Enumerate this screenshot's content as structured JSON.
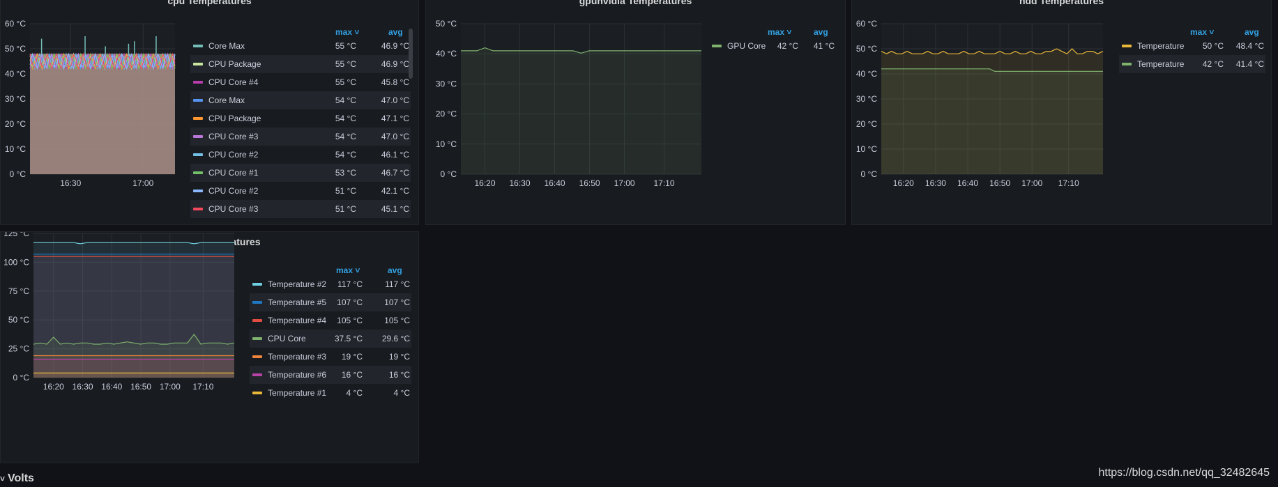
{
  "panels": {
    "cpu": {
      "title": "cpu Temperatures",
      "legend_headers": {
        "max": "max ˅",
        "avg": "avg"
      },
      "legend": [
        {
          "name": "Core Max",
          "max": "55 °C",
          "avg": "46.9 °C",
          "color": "#73bfb8"
        },
        {
          "name": "CPU Package",
          "max": "55 °C",
          "avg": "46.9 °C",
          "color": "#c8e6a0"
        },
        {
          "name": "CPU Core #4",
          "max": "55 °C",
          "avg": "45.8 °C",
          "color": "#b73dae"
        },
        {
          "name": "Core Max",
          "max": "54 °C",
          "avg": "47.0 °C",
          "color": "#5794f2"
        },
        {
          "name": "CPU Package",
          "max": "54 °C",
          "avg": "47.1 °C",
          "color": "#ff9830"
        },
        {
          "name": "CPU Core #3",
          "max": "54 °C",
          "avg": "47.0 °C",
          "color": "#b877d9"
        },
        {
          "name": "CPU Core #2",
          "max": "54 °C",
          "avg": "46.1 °C",
          "color": "#73bfe8"
        },
        {
          "name": "CPU Core #1",
          "max": "53 °C",
          "avg": "46.7 °C",
          "color": "#73bf69"
        },
        {
          "name": "CPU Core #2",
          "max": "51 °C",
          "avg": "42.1 °C",
          "color": "#8ab8ff"
        },
        {
          "name": "CPU Core #3",
          "max": "51 °C",
          "avg": "45.1 °C",
          "color": "#f2495c"
        }
      ]
    },
    "gpu": {
      "title": "gpunvidia Temperatures",
      "legend_headers": {
        "max": "max ˅",
        "avg": "avg"
      },
      "legend": [
        {
          "name": "GPU Core",
          "max": "42 °C",
          "avg": "41 °C",
          "color": "#7eb26d"
        }
      ]
    },
    "hdd": {
      "title": "hdd Temperatures",
      "legend_headers": {
        "max": "max ˅",
        "avg": "avg"
      },
      "legend": [
        {
          "name": "Temperature",
          "max": "50 °C",
          "avg": "48.4 °C",
          "color": "#eab839"
        },
        {
          "name": "Temperature",
          "max": "42 °C",
          "avg": "41.4 °C",
          "color": "#7eb26d"
        }
      ]
    },
    "superio": {
      "title": "superio Temperatures",
      "legend_headers": {
        "max": "max ˅",
        "avg": "avg"
      },
      "legend": [
        {
          "name": "Temperature #2",
          "max": "117 °C",
          "avg": "117 °C",
          "color": "#6ed0e0"
        },
        {
          "name": "Temperature #5",
          "max": "107 °C",
          "avg": "107 °C",
          "color": "#1f78c1"
        },
        {
          "name": "Temperature #4",
          "max": "105 °C",
          "avg": "105 °C",
          "color": "#e24d42"
        },
        {
          "name": "CPU Core",
          "max": "37.5 °C",
          "avg": "29.6 °C",
          "color": "#7eb26d"
        },
        {
          "name": "Temperature #3",
          "max": "19 °C",
          "avg": "19 °C",
          "color": "#ef843c"
        },
        {
          "name": "Temperature #6",
          "max": "16 °C",
          "avg": "16 °C",
          "color": "#ba43a9"
        },
        {
          "name": "Temperature #1",
          "max": "4 °C",
          "avg": "4 °C",
          "color": "#eab839"
        }
      ]
    }
  },
  "chart_data": [
    {
      "type": "area",
      "title": "cpu Temperatures",
      "y_ticks": [
        "0 °C",
        "10 °C",
        "20 °C",
        "30 °C",
        "40 °C",
        "50 °C",
        "60 °C"
      ],
      "x_ticks": [
        "16:30",
        "17:00"
      ],
      "ylim": [
        0,
        60
      ],
      "series_summary": "dense overlapping series, band ~42-48 °C with spikes to ~55 °C",
      "band_low": 42,
      "band_high": 48,
      "spikes": [
        {
          "x": 0.08,
          "y": 54
        },
        {
          "x": 0.38,
          "y": 55
        },
        {
          "x": 0.52,
          "y": 51
        },
        {
          "x": 0.68,
          "y": 52
        },
        {
          "x": 0.87,
          "y": 55
        },
        {
          "x": 0.72,
          "y": 53
        }
      ]
    },
    {
      "type": "line",
      "title": "gpunvidia Temperatures",
      "y_ticks": [
        "0 °C",
        "10 °C",
        "20 °C",
        "30 °C",
        "40 °C",
        "50 °C"
      ],
      "x_ticks": [
        "16:20",
        "16:30",
        "16:40",
        "16:50",
        "17:00",
        "17:10"
      ],
      "ylim": [
        0,
        50
      ],
      "series": [
        {
          "name": "GPU Core",
          "color": "#7eb26d",
          "values": [
            41,
            41,
            41,
            42,
            41,
            41,
            41,
            41,
            41,
            41,
            41,
            41,
            41,
            41,
            41,
            40.2,
            41,
            41,
            41,
            41,
            41,
            41,
            41,
            41,
            41,
            41,
            41,
            41,
            41,
            41,
            41
          ]
        }
      ]
    },
    {
      "type": "area",
      "title": "hdd Temperatures",
      "y_ticks": [
        "0 °C",
        "10 °C",
        "20 °C",
        "30 °C",
        "40 °C",
        "50 °C",
        "60 °C"
      ],
      "x_ticks": [
        "16:20",
        "16:30",
        "16:40",
        "16:50",
        "17:00",
        "17:10"
      ],
      "ylim": [
        0,
        60
      ],
      "series": [
        {
          "name": "Temperature",
          "color": "#eab839",
          "values": [
            49,
            48,
            49,
            48,
            48,
            49,
            48,
            48,
            48,
            49,
            48,
            48,
            49,
            48,
            48,
            48,
            49,
            48,
            48,
            49,
            48,
            48,
            48,
            49,
            48,
            48,
            49,
            48,
            48,
            49,
            48,
            48,
            49,
            49,
            50,
            49,
            48,
            50,
            48,
            48,
            49,
            49,
            48,
            49
          ]
        },
        {
          "name": "Temperature",
          "color": "#7eb26d",
          "values": [
            42,
            42,
            42,
            42,
            42,
            42,
            42,
            42,
            42,
            42,
            42,
            42,
            42,
            42,
            42,
            42,
            42,
            42,
            42,
            42,
            42,
            42,
            41,
            41,
            41,
            41,
            41,
            41,
            41,
            41,
            41,
            41,
            41,
            41,
            41,
            41,
            41,
            41,
            41,
            41,
            41,
            41,
            41,
            41
          ]
        }
      ]
    },
    {
      "type": "area",
      "title": "superio Temperatures",
      "y_ticks": [
        "0 °C",
        "25 °C",
        "50 °C",
        "75 °C",
        "100 °C",
        "125 °C"
      ],
      "x_ticks": [
        "16:20",
        "16:30",
        "16:40",
        "16:50",
        "17:00",
        "17:10"
      ],
      "ylim": [
        0,
        125
      ],
      "series": [
        {
          "name": "Temperature #2",
          "color": "#6ed0e0",
          "values": [
            117,
            117,
            117,
            117,
            117,
            117,
            117,
            116,
            117,
            117,
            117,
            117,
            117,
            117,
            117,
            117,
            117,
            117,
            117,
            117,
            117,
            117,
            117,
            117,
            116,
            117,
            117,
            117,
            117,
            117,
            117
          ]
        },
        {
          "name": "Temperature #5",
          "color": "#1f78c1",
          "values": [
            107,
            107,
            107,
            107,
            107,
            107,
            107,
            107,
            107,
            107,
            107,
            107,
            107,
            107,
            107,
            107,
            107,
            107,
            107,
            107,
            107,
            107,
            107,
            107,
            107,
            107,
            107,
            107,
            107,
            107,
            107
          ]
        },
        {
          "name": "Temperature #4",
          "color": "#e24d42",
          "values": [
            105,
            105,
            105,
            105,
            105,
            105,
            105,
            105,
            105,
            105,
            105,
            105,
            105,
            105,
            105,
            105,
            105,
            105,
            105,
            105,
            105,
            105,
            105,
            105,
            105,
            105,
            105,
            105,
            105,
            105,
            105
          ]
        },
        {
          "name": "CPU Core",
          "color": "#7eb26d",
          "values": [
            29,
            30,
            29,
            35,
            29,
            30,
            29,
            30,
            30,
            29,
            29,
            30,
            29,
            30,
            31,
            30,
            29,
            30,
            30,
            29,
            29,
            30,
            30,
            30,
            37.5,
            29,
            30,
            30,
            30,
            29,
            30
          ]
        },
        {
          "name": "Temperature #3",
          "color": "#ef843c",
          "values": [
            19,
            19,
            19,
            19,
            19,
            19,
            19,
            19,
            19,
            19,
            19,
            19,
            19,
            19,
            19,
            19,
            19,
            19,
            19,
            19,
            19,
            19,
            19,
            19,
            19,
            19,
            19,
            19,
            19,
            19,
            19
          ]
        },
        {
          "name": "Temperature #6",
          "color": "#ba43a9",
          "values": [
            16,
            16,
            16,
            16,
            16,
            16,
            16,
            16,
            16,
            16,
            16,
            16,
            16,
            16,
            16,
            16,
            16,
            16,
            16,
            16,
            16,
            16,
            16,
            16,
            16,
            16,
            16,
            16,
            16,
            16,
            16
          ]
        },
        {
          "name": "Temperature #1",
          "color": "#eab839",
          "values": [
            4,
            4,
            4,
            4,
            4,
            4,
            4,
            4,
            4,
            4,
            4,
            4,
            4,
            4,
            4,
            4,
            4,
            4,
            4,
            4,
            4,
            4,
            4,
            4,
            4,
            4,
            4,
            4,
            4,
            4,
            4
          ]
        }
      ]
    }
  ],
  "row": {
    "title": "Volts",
    "chevron": "˅"
  },
  "watermark": "https://blog.csdn.net/qq_32482645"
}
